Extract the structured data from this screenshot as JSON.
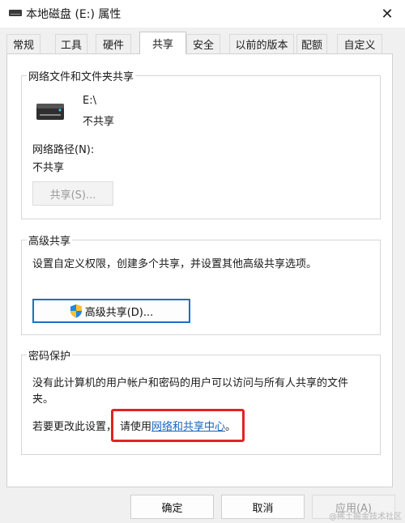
{
  "window": {
    "title": "本地磁盘 (E:) 属性",
    "close_glyph": "✕"
  },
  "tabs": [
    {
      "label": "常规",
      "active": false
    },
    {
      "label": "工具",
      "active": false
    },
    {
      "label": "硬件",
      "active": false
    },
    {
      "label": "共享",
      "active": true
    },
    {
      "label": "安全",
      "active": false
    },
    {
      "label": "以前的版本",
      "active": false
    },
    {
      "label": "配额",
      "active": false
    },
    {
      "label": "自定义",
      "active": false
    }
  ],
  "network_sharing": {
    "group_title": "网络文件和文件夹共享",
    "drive_name": "E:\\",
    "drive_status": "不共享",
    "path_label": "网络路径(N):",
    "path_value": "不共享",
    "share_button": "共享(S)..."
  },
  "advanced_sharing": {
    "group_title": "高级共享",
    "description": "设置自定义权限，创建多个共享，并设置其他高级共享选项。",
    "button": "高级共享(D)..."
  },
  "password_protection": {
    "group_title": "密码保护",
    "description_line1": "没有此计算机的用户帐户和密码的用户可以访问与所有人共享的文件",
    "description_line2": "夹。",
    "change_prefix": "若要更改此设置，",
    "change_middle": "请使用",
    "link_text": "网络和共享中心",
    "change_suffix": "。"
  },
  "buttons": {
    "ok": "确定",
    "cancel": "取消",
    "apply": "应用(A)"
  },
  "watermark": "@稀土掘金技术社区",
  "icons": {
    "title": "drive-icon",
    "shield": "uac-shield-icon",
    "close": "close-icon"
  },
  "colors": {
    "link": "#1565c0",
    "highlight": "#e42222",
    "default_button_border": "#1d6fc2"
  }
}
